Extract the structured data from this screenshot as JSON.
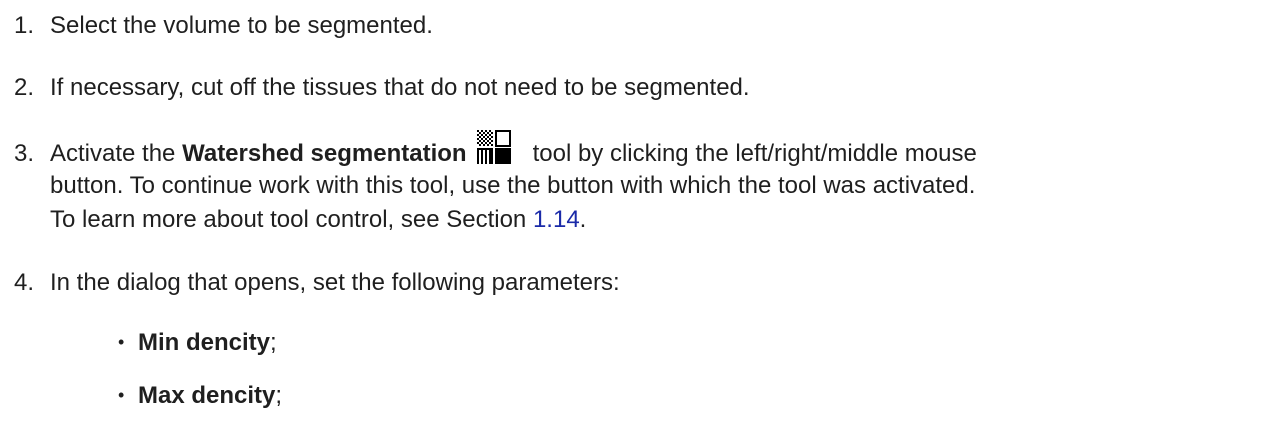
{
  "steps": [
    {
      "number": "1.",
      "text": "Select the volume to be segmented."
    },
    {
      "number": "2.",
      "text": "If necessary, cut off the tissues that do not need to be segmented."
    },
    {
      "number": "3.",
      "prefix": "Activate the ",
      "tool_name": "Watershed segmentation",
      "after_icon": "tool by clicking the left/right/middle mouse",
      "line2": "button. To continue work with this tool, use the button with which the tool was activated.",
      "line3_prefix": "To learn more about tool control, see Section ",
      "section_link": "1.14",
      "line3_suffix": "."
    },
    {
      "number": "4.",
      "text": "In the dialog that opens, set the following parameters:"
    }
  ],
  "bullets": [
    {
      "marker": "•",
      "label": "Min dencity",
      "suffix": ";"
    },
    {
      "marker": "•",
      "label": "Max dencity",
      "suffix": ";"
    }
  ],
  "icons": {
    "tool": "watershed-segmentation-icon"
  },
  "colors": {
    "text": "#1f1f1f",
    "link": "#1a2aa8"
  }
}
